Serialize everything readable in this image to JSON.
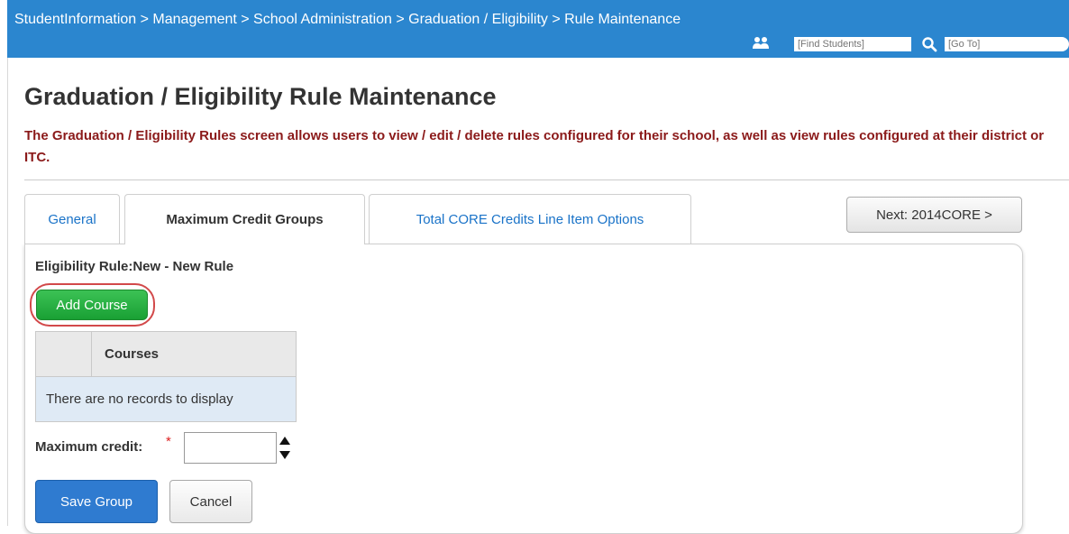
{
  "header": {
    "breadcrumb": "StudentInformation > Management > School Administration > Graduation / Eligibility > Rule Maintenance",
    "find_students_placeholder": "[Find Students]",
    "goto_placeholder": "[Go To]",
    "bar_color": "#2b86cf"
  },
  "page": {
    "title": "Graduation / Eligibility Rule Maintenance",
    "description": "The Graduation / Eligibility Rules screen allows users to view / edit / delete rules configured for their school, as well as view rules configured at their district or ITC."
  },
  "tabs": [
    {
      "label": "General",
      "active": false
    },
    {
      "label": "Maximum Credit Groups",
      "active": true
    },
    {
      "label": "Total CORE Credits Line Item Options",
      "active": false
    }
  ],
  "next_button": "Next: 2014CORE >",
  "panel": {
    "rule_label": "Eligibility Rule:",
    "rule_value": "New - New Rule",
    "add_course_label": "Add Course",
    "table": {
      "header": "Courses",
      "empty_message": "There are no records to display"
    },
    "max_credit_label": "Maximum credit:",
    "required_marker": "*",
    "max_credit_value": "",
    "save_label": "Save Group",
    "cancel_label": "Cancel"
  },
  "colors": {
    "accent": "#2f7bd0",
    "add_button": "#19a034",
    "highlight_ring": "#d2494a",
    "description_text": "#8b1a1a"
  },
  "icons": [
    "people-icon",
    "search-icon",
    "spinner-arrows-icon"
  ]
}
